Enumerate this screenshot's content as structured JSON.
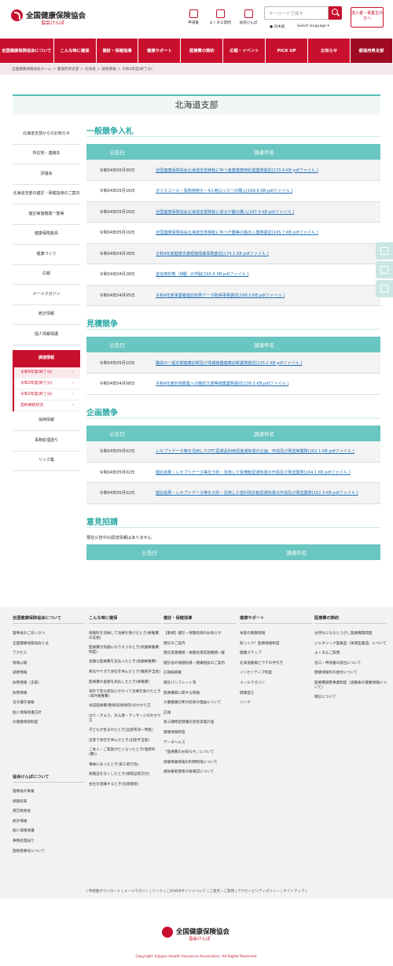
{
  "header": {
    "logo_title": "全国健康保険協会",
    "logo_sub": "協会けんぽ",
    "icons": [
      {
        "label": "申請書",
        "icon": "document-icon"
      },
      {
        "label": "よくある質問",
        "icon": "question-icon"
      },
      {
        "label": "協会けんぽ",
        "icon": "building-icon"
      }
    ],
    "search_placeholder": "キーワードで探す",
    "lang_jp": "日本語",
    "lang_select": "Select language",
    "member_btn": "加入者・事業主の方へ"
  },
  "nav": [
    "全国健康保険協会について",
    "こんな時に健保",
    "健診・保健指導",
    "健康サポート",
    "医療費の節約",
    "広報・イベント",
    "PICK UP",
    "お知らせ",
    "都道府県支部"
  ],
  "breadcrumb": "全国健康保険協会ホーム ＞ 都道府県支部 ＞ 北海道 ＞ 調達情報 ＞ 令和4年度(終了分)",
  "page_title": "北海道支部",
  "sidebar": {
    "items": [
      "北海道支部からのお知らせ",
      "所在地・連絡先",
      "評議会",
      "北海道支部の健診・保健指導のご案内",
      "健診実施機関一覧等",
      "健康保険委員",
      "健康づくり",
      "広報",
      "メールマガジン",
      "統計情報",
      "個人情報保護"
    ],
    "head": "調達情報",
    "subs": [
      "令和4年度(終了分)",
      "令和3年度(終了分)",
      "令和2年度(終了分)",
      "契約締結状況"
    ],
    "items2": [
      "採用情報",
      "事務処理誤り",
      "リンク集"
    ]
  },
  "table_headers": {
    "date": "公告日",
    "subject": "調達件名"
  },
  "sections": [
    {
      "title": "一般競争入札",
      "rows": [
        {
          "date": "令和04年05月30日",
          "subject": "全国健康保険協会北海道支部移転に伴う産業廃棄物処理業務委託[170.9 KB pdfファイル ]"
        },
        {
          "date": "令和04年05月16日",
          "subject": "ポイスコール・事務用椅子・4人用ロッカーの購入[169.8 KB pdfファイル ]"
        },
        {
          "date": "令和04年05月16日",
          "subject": "全国健康保険協会北海道支部移転に係る什器の購入[167.9 KB pdfファイル ]"
        },
        {
          "date": "令和04年05月16日",
          "subject": "全国健康保険協会北海道支部移転に伴う什器等の搬出入業務委託[165.7 KB pdfファイル ]"
        },
        {
          "date": "令和04年04月28日",
          "subject": "令和4年度健康支援経路情報事務委託[174.1 KB pdfファイル ]"
        },
        {
          "date": "令和04年04月28日",
          "subject": "送信用封筒（8種）の作製[165.6 KB pdfファイル ]"
        },
        {
          "date": "令和04年04月05日",
          "subject": "令和4年度事業者健診結果データ取得事務委託[168.0 KB pdfファイル ]"
        }
      ]
    },
    {
      "title": "見積競争",
      "rows": [
        {
          "date": "令和04年05月10日",
          "subject": "職員の一般定期健康診断及び情報機器健康診断業務委託[135.2 KB pdfファイル ]"
        },
        {
          "date": "令和04年04月08日",
          "subject": "令和4年度外部募集への機密文書等廃棄業務委託[139.3 KB pdfファイル ]"
        }
      ]
    },
    {
      "title": "企画競争",
      "rows": [
        {
          "date": "令和04年05月02日",
          "subject": "レセプトデータ等を活用したOTC医薬品利用促進通知書の企画、作成及び発送等業務[162.1 KB pdfファイル ]"
        },
        {
          "date": "令和04年05月02日",
          "subject": "健診結果・レセプトデータ等を分析・活用した受療勧奨通知書の作成及び発送業務[164.1 KB pdfファイル ]"
        },
        {
          "date": "令和04年05月02日",
          "subject": "健診結果・レセプトデータ等を分析・活用した歯科受診勧奨通知書の作成及び発送業務[162.3 KB pdfファイル ]"
        }
      ]
    },
    {
      "title": "意見招請",
      "note": "現在公告中の調達情報はありません",
      "rows": []
    }
  ],
  "footer": {
    "cols": [
      {
        "head": "全国健康保険協会について",
        "links": [
          "理事長のごあいさつ",
          "全国健康保険協会とは",
          "アクセス",
          "情報公開",
          "調達情報",
          "採用情報（支部）",
          "採用情報",
          "法令遵守通報",
          "個人情報保護方針",
          "の健康保険制度"
        ]
      },
      {
        "head": "こんな時に健保",
        "links": [
          "保険料を滞納して治療を受けたとき(療養費の支給)",
          "医療費が高額になりそうなとき(高額療養費制度)",
          "高額な医療費を支払ったとき(高額療養費)",
          "病気やケガで会社を休んだとき(傷病手当金)",
          "医療費の金額を高払したとき(療養費)",
          "海外で急な病気にかかって治療を受けたとき(海外療養費)",
          "承認医療費(整骨院/接骨院)のかかり方",
          "はり・きゅう、あん摩・マッサージのかかり方",
          "子どもが生まれたとき(出産育児一時金)",
          "出産で会社を休んだとき(出産手当金)",
          "ご本人・ご家族が亡くなったとき(埋葬料(費))",
          "事故にあったとき(第三者行為)",
          "保険証をなくしたとき(保険証再交付)",
          "会社を退職するとき(任意継続)"
        ]
      },
      {
        "head": "健診・保健指導",
        "links": [
          "【重要】健診・保健指導のお知らせ",
          "健診のご案内",
          "健診実施機関・保健指導実施機関一覧",
          "健診会の保健指導・健康相談のご案内",
          "広報紙掲載",
          "健診パンフレット等",
          "医療機関に関する情報",
          "大腸健康診断の結果の理由について",
          "広報",
          "第三期特定健康診査等実施計画",
          "健康保険制度",
          "データヘルス",
          "「医療費のお知らせ」について",
          "保健事業情報の利用制限について",
          "被扶養者資格の再確認について"
        ]
      },
      {
        "head": "健康サポート",
        "links": [
          "本部の健康情報",
          "知っトク！医療保険制度",
          "健康ステップ",
          "北海道健康ビラテの手引き",
          "インセンティブ制度",
          "メールマガジン",
          "健康宣言",
          "リンク"
        ]
      },
      {
        "head": "医療費の節約",
        "links": [
          "お持ちになるとうさし医療機関関連",
          "ジェネリック医薬品（後発医薬品）について",
          "よくあるご質問",
          "窓口・申請書の提出について",
          "健康保険料の給付について",
          "医療費調整事業制度（退職後の健康保険について）",
          "健診について"
        ]
      }
    ],
    "sub_head": "協会けんぽについて",
    "sub_links": [
      "理事長の事業",
      "保険料率",
      "運営委員会",
      "統計情報",
      "個人情報保護",
      "事務処理誤り",
      "国保者番号について"
    ],
    "bottom_links": "| 申請書ダウンロード | メールマガジン | リンク | このWEBサイトについて | ご意見・ご質問 | アクセシビリティポリシー | サイトマップ |",
    "logo_title": "全国健康保険協会",
    "logo_sub": "協会けんぽ",
    "copyright": "Copyright ©Japan Health Insurance Association. All Rights Reserved."
  }
}
